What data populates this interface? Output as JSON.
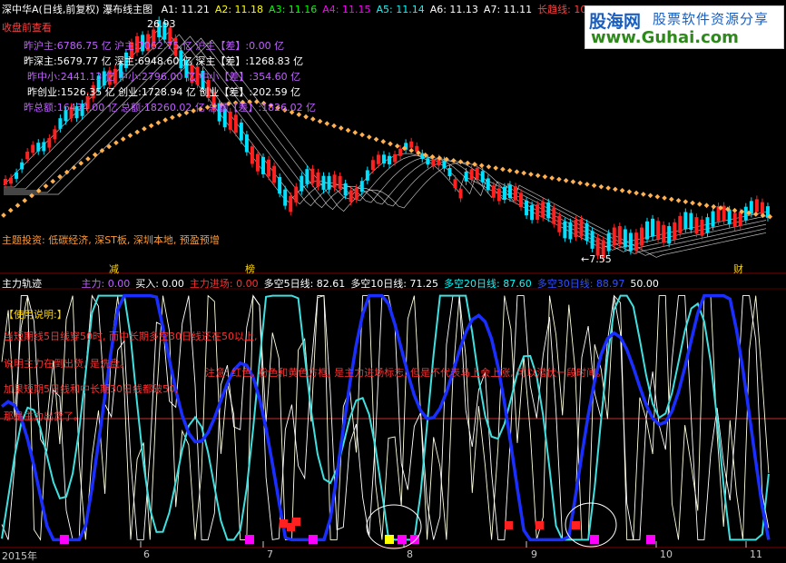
{
  "top_panel": {
    "title": "深中华A(日线,前复权) 瀑布线主图",
    "indicators": [
      {
        "label": "A1: 11.21",
        "color": "#ffffff"
      },
      {
        "label": "A2: 11.18",
        "color": "#ffff00"
      },
      {
        "label": "A3: 11.16",
        "color": "#00ff00"
      },
      {
        "label": "A4: 11.15",
        "color": "#ff00ff"
      },
      {
        "label": "A5: 11.14",
        "color": "#00ffff"
      },
      {
        "label": "A6: 11.13",
        "color": "#ffffff"
      },
      {
        "label": "A7: 11.11",
        "color": "#ffffff"
      },
      {
        "label": "长趋线: 10.",
        "color": "#ff4040"
      }
    ],
    "price_high_label": "26.93",
    "price_low_label": "7.55",
    "close_review_link": "收盘前查看",
    "market_stats": [
      {
        "text": "昨沪主:6786.75 亿 沪主:7062.75 亿 沪主【差】:0.00 亿",
        "color": "#c060ff"
      },
      {
        "text": "昨深主:5679.77 亿 深主:6948.60 亿 深主【差】:1268.83 亿",
        "color": "#ffffff"
      },
      {
        "text": "昨中小:2441.13 亿 中小:2796.00 亿 中小【差】:354.60 亿",
        "color": "#c060ff"
      },
      {
        "text": "昨创业:1526.35 亿 创业:1728.94 亿 创业【差】:202.59 亿",
        "color": "#ffffff"
      },
      {
        "text": "昨总额:16434.00 亿 总额:18260.02 亿 总额【差】:1826.02 亿",
        "color": "#c060ff"
      }
    ],
    "theme_text": "主题投资: 低碳经济, 深ST板, 深圳本地, 预盈预增",
    "event_markers": [
      "减",
      "榜",
      "财"
    ]
  },
  "bottom_panel": {
    "title": "主力轨迹",
    "indicators": [
      {
        "label": "主力: 0.00",
        "color": "#c060ff"
      },
      {
        "label": "买入: 0.00",
        "color": "#ffffff"
      },
      {
        "label": "主力进场: 0.00",
        "color": "#ff3030"
      },
      {
        "label": "多空5日线: 82.61",
        "color": "#ffffff"
      },
      {
        "label": "多空10日线: 71.25",
        "color": "#ffffff"
      },
      {
        "label": "多空20日线: 87.60",
        "color": "#00ffff"
      },
      {
        "label": "多空30日线: 88.97",
        "color": "#3050ff"
      },
      {
        "label": "50.00",
        "color": "#ffffff"
      }
    ],
    "explain_header": "【使用说明:】",
    "explain_lines": [
      "当短期线5日线穿50时, 而中长期多空30日线还在50以上,",
      "说明主力在倒出货, 是洗盘。",
      "加果短期5日线和中长期30日线都破50,",
      "那是主力出货了。"
    ],
    "note_text": "注意: 红色, 粉色和黄色方框, 是主力进场标志, 但是不代表马上会上涨, 可以潜伏一段时间。"
  },
  "x_axis": {
    "labels": [
      "2015年",
      "6",
      "7",
      "8",
      "9",
      "10",
      "11"
    ]
  },
  "watermark": {
    "brand_cn": "股海网",
    "brand_sub": "股票软件资源分享",
    "url": "www.Guhai.com"
  },
  "colors": {
    "up": "#ff2020",
    "down": "#00e0ff",
    "waterfall": "#ffffff",
    "long_trend": "#ffb050",
    "line5": "#ffffe0",
    "line10": "#ffffff",
    "line20": "#40e0e0",
    "line30": "#1a2fff",
    "mid": "#c03030"
  }
}
